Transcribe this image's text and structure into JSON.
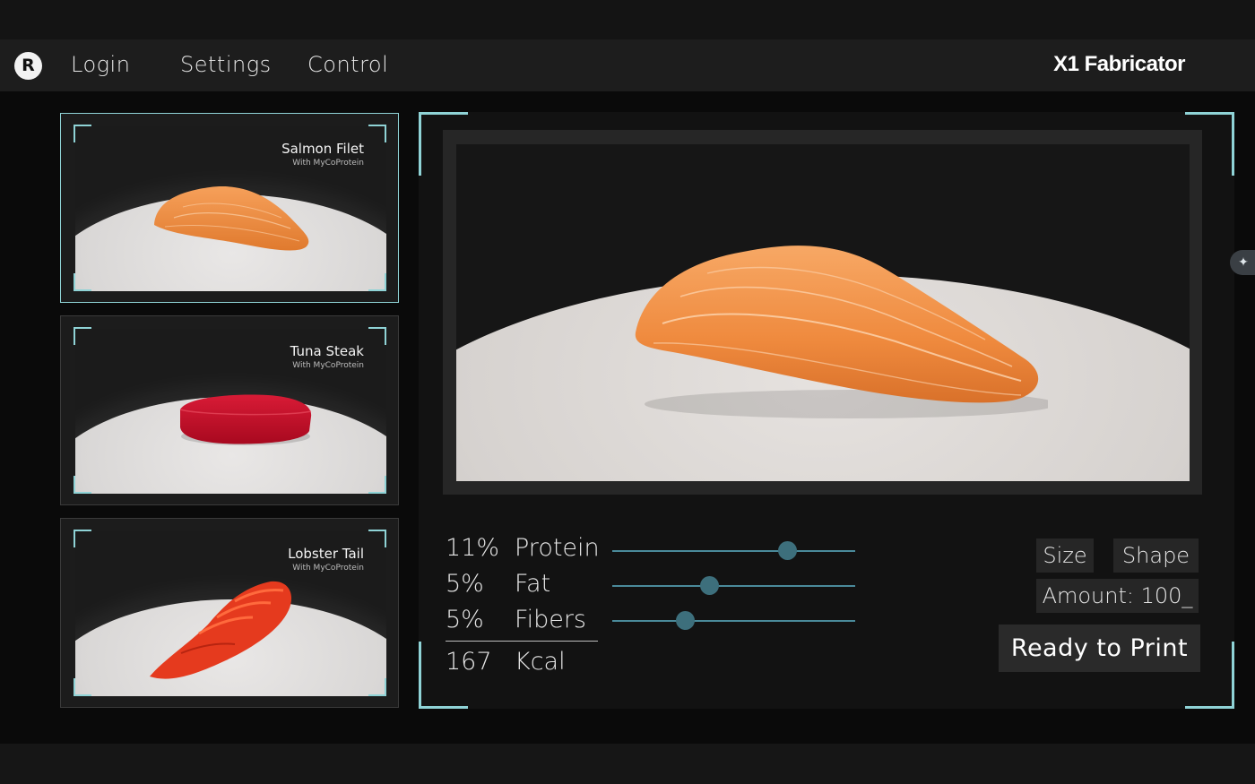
{
  "nav": {
    "logo_letter": "R",
    "items": [
      {
        "label": "Login"
      },
      {
        "label": "Settings"
      },
      {
        "label": "Control"
      }
    ],
    "brand": "X1 Fabricator"
  },
  "products": [
    {
      "title": "Salmon Filet",
      "subtitle": "With MyCoProtein",
      "selected": true
    },
    {
      "title": "Tuna Steak",
      "subtitle": "With MyCoProtein",
      "selected": false
    },
    {
      "title": "Lobster Tail",
      "subtitle": "With MyCoProtein",
      "selected": false
    }
  ],
  "nutrition": {
    "rows": [
      {
        "value": "11%",
        "label": "Protein",
        "slider_level": 0.72
      },
      {
        "value": "5%",
        "label": "Fat",
        "slider_level": 0.4
      },
      {
        "value": "5%",
        "label": "Fibers",
        "slider_level": 0.3
      }
    ],
    "total_value": "167",
    "total_label": "Kcal"
  },
  "options": {
    "size_label": "Size",
    "shape_label": "Shape",
    "amount_label": "Amount: 100_"
  },
  "print_label": "Ready to Print",
  "colors": {
    "accent": "#8fd3d6",
    "slider_track": "#4a8a9a",
    "slider_thumb": "#3d6f7c",
    "salmon": "#f08a3e",
    "tuna": "#c8102e",
    "lobster": "#e8361c"
  },
  "icons": {
    "logo": "r-logo-icon",
    "side_widget": "sparkle-icon"
  }
}
